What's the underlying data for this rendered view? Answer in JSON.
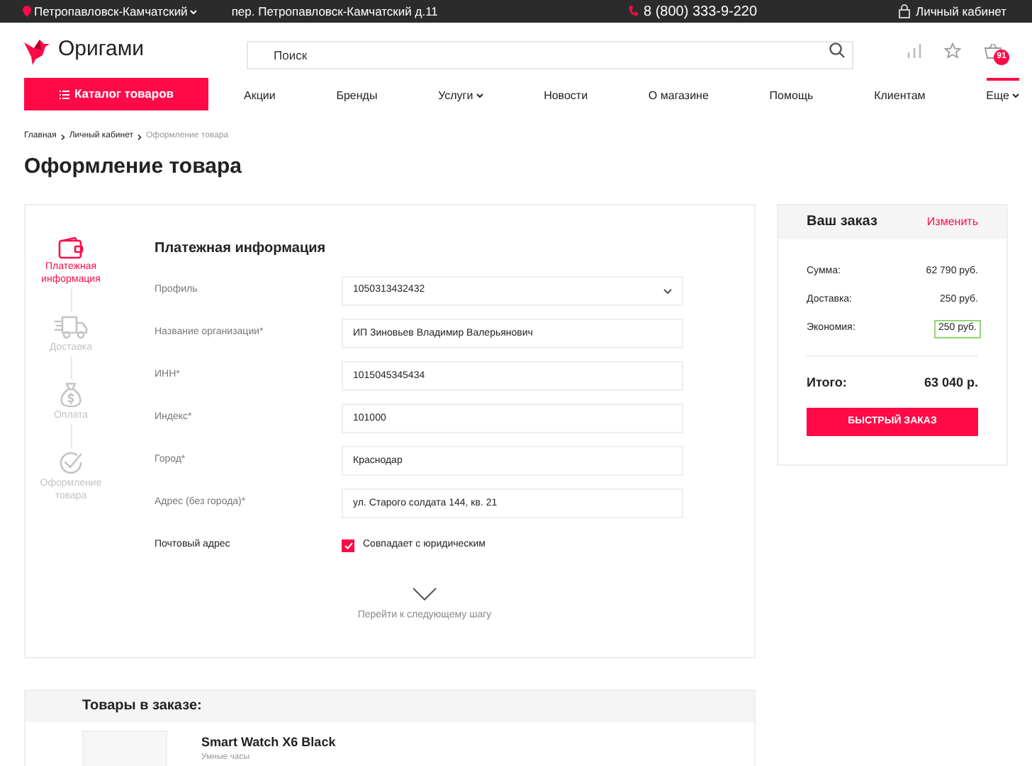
{
  "topbar": {
    "city": "Петропавловск-Камчатский",
    "address": "пер. Петропавловск-Камчатский д.11",
    "phone": "8 (800) 333-9-220",
    "account": "Личный кабинет"
  },
  "header": {
    "logo": "Оригами",
    "search": {
      "placeholder": "Поиск"
    },
    "cart_count": "91"
  },
  "nav": {
    "catalog": "Каталог товаров",
    "items": [
      {
        "label": "Акции",
        "dropdown": false,
        "selected": false
      },
      {
        "label": "Бренды",
        "dropdown": false,
        "selected": false
      },
      {
        "label": "Услуги",
        "dropdown": true,
        "selected": false
      },
      {
        "label": "Новости",
        "dropdown": false,
        "selected": false
      },
      {
        "label": "О магазине",
        "dropdown": false,
        "selected": false
      },
      {
        "label": "Помощь",
        "dropdown": false,
        "selected": false
      },
      {
        "label": "Клиентам",
        "dropdown": false,
        "selected": false
      },
      {
        "label": "Еще",
        "dropdown": true,
        "selected": true
      }
    ]
  },
  "breadcrumbs": [
    "Главная",
    "Личный кабинет",
    "Оформление товара"
  ],
  "title": "Оформление товара",
  "steps": [
    {
      "kind": "wallet",
      "label": "Платежная информация",
      "selected": true
    },
    {
      "kind": "truck",
      "label": "Доставка",
      "selected": false
    },
    {
      "kind": "money",
      "label": "Оплата",
      "selected": false
    },
    {
      "kind": "check",
      "label": "Оформление товара",
      "selected": false
    }
  ],
  "form": {
    "heading": "Платежная информация",
    "fields": [
      {
        "kind": "select",
        "label": "Профиль",
        "value": "1050313432432"
      },
      {
        "kind": "input",
        "label": "Название организации*",
        "value": "ИП Зиновьев Владимир Валерьянович"
      },
      {
        "kind": "input",
        "label": "ИНН*",
        "value": "1015045345434"
      },
      {
        "kind": "input",
        "label": "Индекс*",
        "value": "101000"
      },
      {
        "kind": "input",
        "label": "Город*",
        "value": "Краснодар"
      },
      {
        "kind": "input",
        "label": "Адрес (без города)*",
        "value": "ул. Старого солдата 144, кв. 21"
      },
      {
        "kind": "checkbox",
        "label": "Почтовый адрес",
        "value": "Совпадает с юридическим",
        "checked": true
      }
    ],
    "next": "Перейти к следующему шагу"
  },
  "order": {
    "title": "Ваш заказ",
    "edit": "Изменить",
    "lines": [
      {
        "label": "Сумма:",
        "value": "62 790 руб.",
        "highlighted": false
      },
      {
        "label": "Доставка:",
        "value": "250 руб.",
        "highlighted": false
      },
      {
        "label": "Экономия:",
        "value": "250 руб.",
        "highlighted": true
      }
    ],
    "total_label": "Итого:",
    "total": "63 040 р.",
    "button": "БЫСТРЫЙ ЗАКАЗ"
  },
  "products": {
    "title": "Товары в заказе:",
    "items": [
      {
        "name": "Smart Watch X6 Black",
        "category": "Умные часы"
      }
    ]
  }
}
